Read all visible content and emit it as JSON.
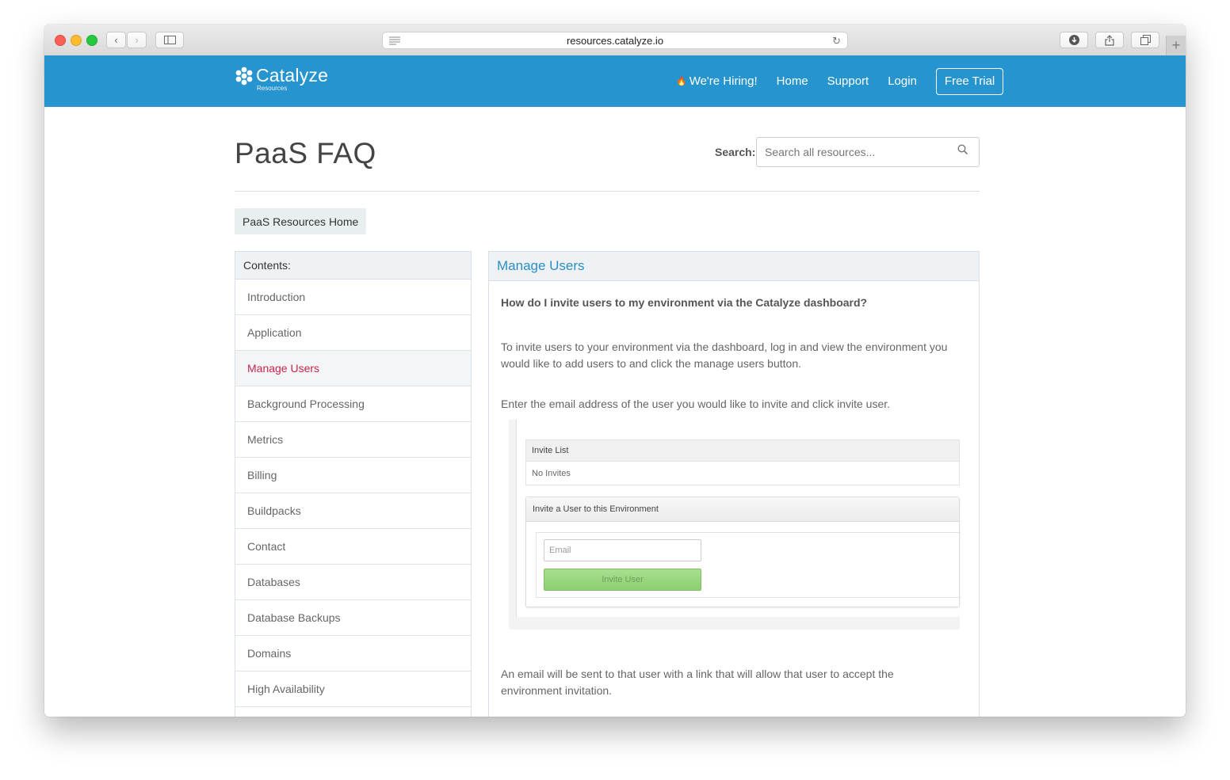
{
  "browser": {
    "url": "resources.catalyze.io"
  },
  "site": {
    "logo_name": "Catalyze",
    "logo_sub": "Resources",
    "nav": {
      "hiring": "We're Hiring!",
      "home": "Home",
      "support": "Support",
      "login": "Login",
      "free_trial": "Free Trial"
    }
  },
  "page": {
    "title": "PaaS FAQ",
    "search_label": "Search:",
    "search_placeholder": "Search all resources...",
    "home_button": "PaaS Resources Home"
  },
  "sidebar": {
    "heading": "Contents:",
    "items": [
      {
        "label": "Introduction"
      },
      {
        "label": "Application"
      },
      {
        "label": "Manage Users",
        "active": true
      },
      {
        "label": "Background Processing"
      },
      {
        "label": "Metrics"
      },
      {
        "label": "Billing"
      },
      {
        "label": "Buildpacks"
      },
      {
        "label": "Contact"
      },
      {
        "label": "Databases"
      },
      {
        "label": "Database Backups"
      },
      {
        "label": "Domains"
      },
      {
        "label": "High Availability"
      }
    ]
  },
  "panel": {
    "title": "Manage Users",
    "question": "How do I invite users to my environment via the Catalyze dashboard?",
    "para1": "To invite users to your environment via the dashboard, log in and view the environment you would like to add users to and click the manage users button.",
    "para2": "Enter the email address of the user you would like to invite and click invite user.",
    "para3": "An email will be sent to that user with a link that will allow that user to accept the environment invitation.",
    "screenshot": {
      "invite_list_heading": "Invite List",
      "invite_list_empty": "No Invites",
      "invite_box_heading": "Invite a User to this Environment",
      "email_placeholder": "Email",
      "invite_button": "Invite User"
    }
  },
  "colors": {
    "header_blue": "#2594cf",
    "active_item": "#c7254e",
    "panel_title": "#2b8fc5",
    "invite_green": "#a9df8f"
  }
}
